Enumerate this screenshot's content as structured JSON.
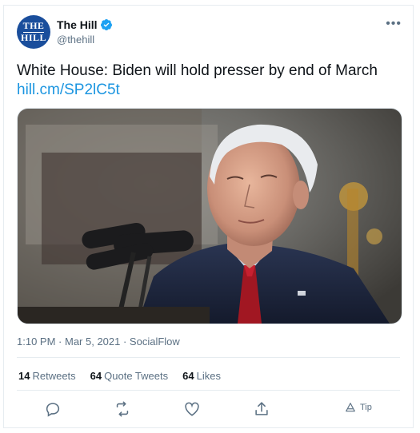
{
  "author": {
    "display_name": "The Hill",
    "handle": "@thehill",
    "avatar_text_top": "THE",
    "avatar_text_bottom": "HILL"
  },
  "tweet": {
    "text": "White House: Biden will hold presser by end of March",
    "link": "hill.cm/SP2lC5t"
  },
  "meta": {
    "time": "1:10 PM",
    "date": "Mar 5, 2021",
    "source": "SocialFlow",
    "separator": " · "
  },
  "stats": {
    "retweets_count": "14",
    "retweets_label": "Retweets",
    "quotes_count": "64",
    "quotes_label": "Quote Tweets",
    "likes_count": "64",
    "likes_label": "Likes"
  },
  "actions": {
    "tip_label": "Tip"
  },
  "icons": {
    "more": "more-icon",
    "verified": "verified-icon",
    "reply": "reply-icon",
    "retweet": "retweet-icon",
    "like": "heart-icon",
    "share": "share-icon",
    "tip": "tip-icon"
  },
  "colors": {
    "link": "#1b95e0",
    "verified": "#1da1f2",
    "secondary_text": "#5b7083",
    "avatar_bg": "#1a4e9c"
  }
}
